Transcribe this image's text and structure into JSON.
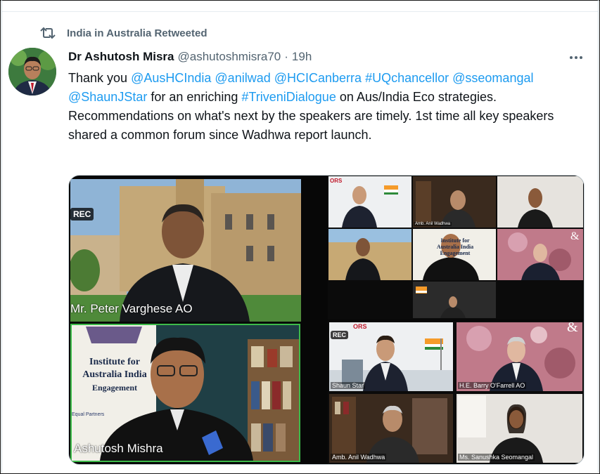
{
  "retweet": {
    "text": "India in Australia Retweeted",
    "icon": "retweet-icon"
  },
  "tweet": {
    "author_name": "Dr Ashutosh Misra",
    "handle": "@ashutoshmisra70",
    "separator": "·",
    "time": "19h",
    "body": [
      {
        "text": "Thank you ",
        "link": false
      },
      {
        "text": "@AusHCIndia",
        "link": true
      },
      {
        "text": " ",
        "link": false
      },
      {
        "text": "@anilwad",
        "link": true
      },
      {
        "text": " ",
        "link": false
      },
      {
        "text": "@HCICanberra",
        "link": true
      },
      {
        "text": " ",
        "link": false
      },
      {
        "text": "#UQchancellor",
        "link": true
      },
      {
        "text": " ",
        "link": false
      },
      {
        "text": "@sseomangal",
        "link": true
      },
      {
        "text": " ",
        "link": false
      },
      {
        "text": "@ShaunJStar",
        "link": true
      },
      {
        "text": " for an enriching ",
        "link": false
      },
      {
        "text": "#TriveniDialogue",
        "link": true
      },
      {
        "text": " on Aus/India Eco strategies.  Recommendations on what's next by the speakers are timely. 1st time all key speakers shared a common forum since Wadhwa report launch.",
        "link": false
      }
    ]
  },
  "media": {
    "left_top": {
      "rec": "REC",
      "name": "Mr. Peter Varghese AO"
    },
    "left_bottom": {
      "banner_line1": "Institute for",
      "banner_line2": "Australia India",
      "banner_line3": "Engagement",
      "banner_footer": "Equal Partners",
      "name": "Ashutosh Mishra"
    },
    "right_top": {
      "logo": "ORS",
      "banner_line1": "Institute for",
      "banner_line2": "Australia India",
      "banner_line3": "Engagement",
      "amp": "&",
      "tile_small_label": "Amb. Anil Wadhwa"
    },
    "right_bottom": {
      "rec": "REC",
      "logo": "ORS",
      "amp": "&",
      "labels": [
        "Shaun Star",
        "H.E. Barry O'Farrell AO",
        "Amb. Anil Wadhwa",
        "Ms. Sanushka Seomangal"
      ]
    }
  },
  "colors": {
    "link": "#1d9bf0",
    "muted": "#536471",
    "text": "#0f1419"
  }
}
